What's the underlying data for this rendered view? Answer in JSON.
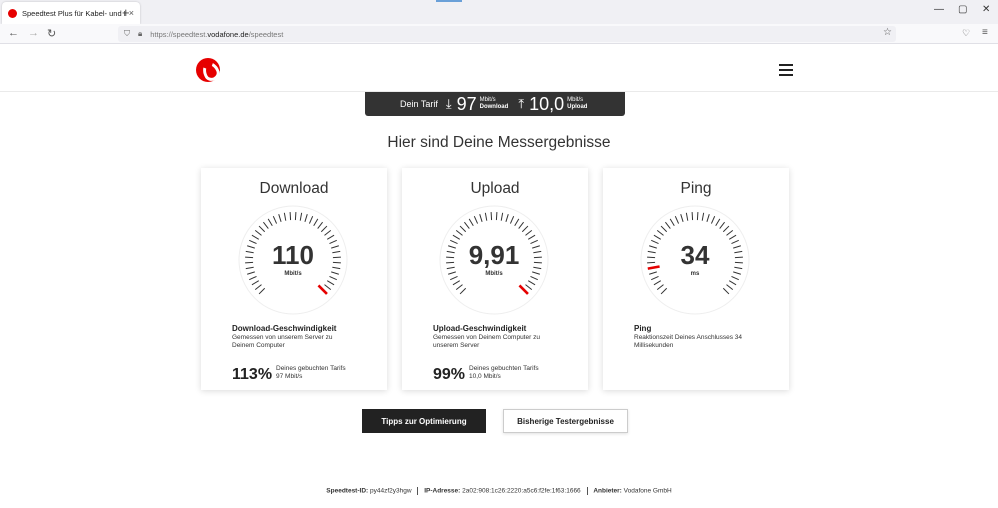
{
  "browser": {
    "tab_title": "Speedtest Plus für Kabel- und D",
    "tab_close": "×",
    "new_tab": "+",
    "url_host_prefix": "https://speedtest.",
    "url_host": "vodafone.de",
    "url_path": "/speedtest"
  },
  "tariff": {
    "label": "Dein Tarif",
    "download_value": "97",
    "download_unit": "Mbit/s",
    "download_label": "Download",
    "upload_value": "10,0",
    "upload_unit": "Mbit/s",
    "upload_label": "Upload"
  },
  "headline": "Hier sind Deine Messergebnisse",
  "cards": [
    {
      "title": "Download",
      "value": "110",
      "unit": "Mbit/s",
      "info_title": "Download-Geschwindigkeit",
      "info_desc": "Gemessen von unserem Server zu Deinem Computer",
      "pct": "113%",
      "pct_desc_line1": "Deines gebuchten Tarifs",
      "pct_desc_line2": "97 Mbit/s",
      "level": 1.0
    },
    {
      "title": "Upload",
      "value": "9,91",
      "unit": "Mbit/s",
      "info_title": "Upload-Geschwindigkeit",
      "info_desc": "Gemessen von Deinem Computer zu unserem Server",
      "pct": "99%",
      "pct_desc_line1": "Deines gebuchten Tarifs",
      "pct_desc_line2": "10,0 Mbit/s",
      "level": 1.0
    },
    {
      "title": "Ping",
      "value": "34",
      "unit": "ms",
      "info_title": "Ping",
      "info_desc": "Reaktionszeit Deines Anschlusses 34 Millisekunden",
      "level": 0.12
    }
  ],
  "buttons": {
    "tips": "Tipps zur Optimierung",
    "history": "Bisherige Testergebnisse"
  },
  "footer": {
    "id_label": "Speedtest-ID:",
    "id_value": "py44zf2y3hgw",
    "ip_label": "IP-Adresse:",
    "ip_value": "2a02:908:1c26:2220:a5c6:f2fe:1f63:1666",
    "provider_label": "Anbieter:",
    "provider_value": "Vodafone GmbH"
  },
  "colors": {
    "brand": "#e60000",
    "dark": "#222222"
  }
}
